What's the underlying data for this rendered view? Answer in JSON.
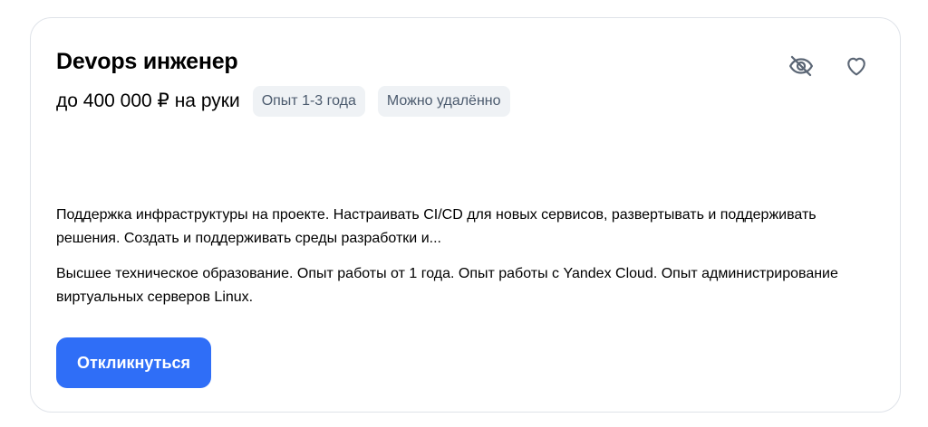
{
  "vacancy": {
    "title": "Devops инженер",
    "salary": "до 400 000 ₽ на руки",
    "tags": [
      "Опыт 1-3 года",
      "Можно удалённо"
    ],
    "description": "Поддержка инфраструктуры на проекте. Настраивать CI/CD для новых сервисов, развертывать и поддерживать решения. Создать и поддерживать среды разработки и...",
    "requirements": "Высшее техническое образование. Опыт работы от 1 года. Опыт работы с Yandex Cloud. Опыт администрирование виртуальных серверов Linux.",
    "apply_label": "Откликнуться"
  },
  "actions": {
    "hide_icon": "eye-off-icon",
    "favorite_icon": "heart-icon"
  },
  "colors": {
    "accent": "#2f6ef7",
    "tag_background": "#eff2f5",
    "tag_text": "#4c5b6e",
    "icon": "#5b6675",
    "border": "#dfe3e9"
  }
}
